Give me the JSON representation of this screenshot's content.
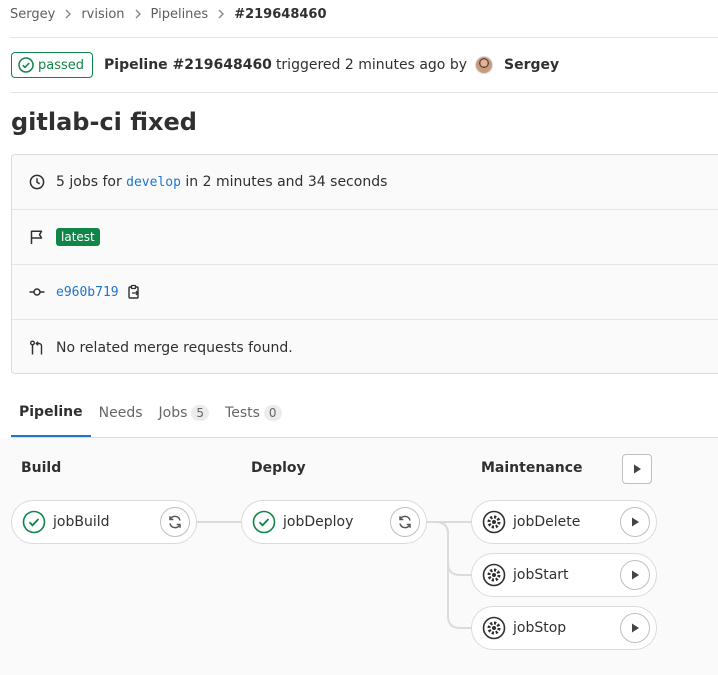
{
  "breadcrumb": [
    "Sergey",
    "rvision",
    "Pipelines",
    "#219648460"
  ],
  "header": {
    "status": "passed",
    "pipeline_label": "Pipeline #219648460",
    "triggered_text": "triggered 2 minutes ago by",
    "user": "Sergey"
  },
  "title": "gitlab-ci fixed",
  "info": {
    "jobs_prefix": "5 jobs for",
    "branch": "develop",
    "duration": "in 2 minutes and 34 seconds",
    "tag": "latest",
    "commit": "e960b719",
    "merge_requests": "No related merge requests found."
  },
  "tabs": [
    {
      "label": "Pipeline",
      "count": null
    },
    {
      "label": "Needs",
      "count": null
    },
    {
      "label": "Jobs",
      "count": "5"
    },
    {
      "label": "Tests",
      "count": "0"
    }
  ],
  "stages": [
    {
      "name": "Build",
      "jobs": [
        {
          "name": "jobBuild",
          "status": "success",
          "action": "retry"
        }
      ]
    },
    {
      "name": "Deploy",
      "jobs": [
        {
          "name": "jobDeploy",
          "status": "success",
          "action": "retry"
        }
      ]
    },
    {
      "name": "Maintenance",
      "jobs": [
        {
          "name": "jobDelete",
          "status": "manual",
          "action": "play"
        },
        {
          "name": "jobStart",
          "status": "manual",
          "action": "play"
        },
        {
          "name": "jobStop",
          "status": "manual",
          "action": "play"
        }
      ]
    }
  ],
  "colors": {
    "success": "#108548",
    "link": "#1f75cb",
    "text": "#303030"
  }
}
